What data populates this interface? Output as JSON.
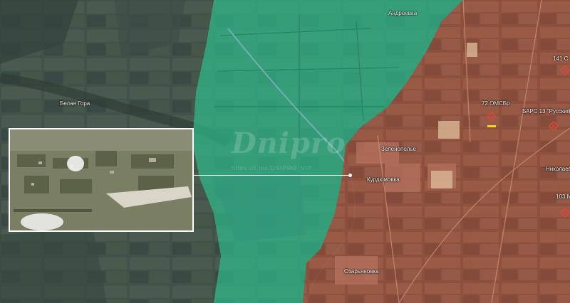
{
  "map": {
    "places": {
      "andreevka": "Андреевка",
      "belaya_gora": "Белая Гора",
      "zelenopolye": "Зеленополье",
      "kurdyumovka": "Курдюмовка",
      "ozaryanovka": "Озарьяновка",
      "nikolaevka": "Николаевк"
    },
    "units": {
      "omsbr_72": "72 ОМСБр",
      "bars_13": "БАРС 13 \"Русский Ле",
      "unit_141": "141 С",
      "unit_103": "103 М"
    },
    "watermark": {
      "brand": "Dnipro",
      "sub": "https://t.me/DNIPRO_VIP"
    },
    "colors": {
      "ukrainian_zone": "#2fb88a",
      "russian_zone": "#a24a3a",
      "marker_red": "#d64a3a",
      "marker_yellow": "#f0d420"
    }
  }
}
